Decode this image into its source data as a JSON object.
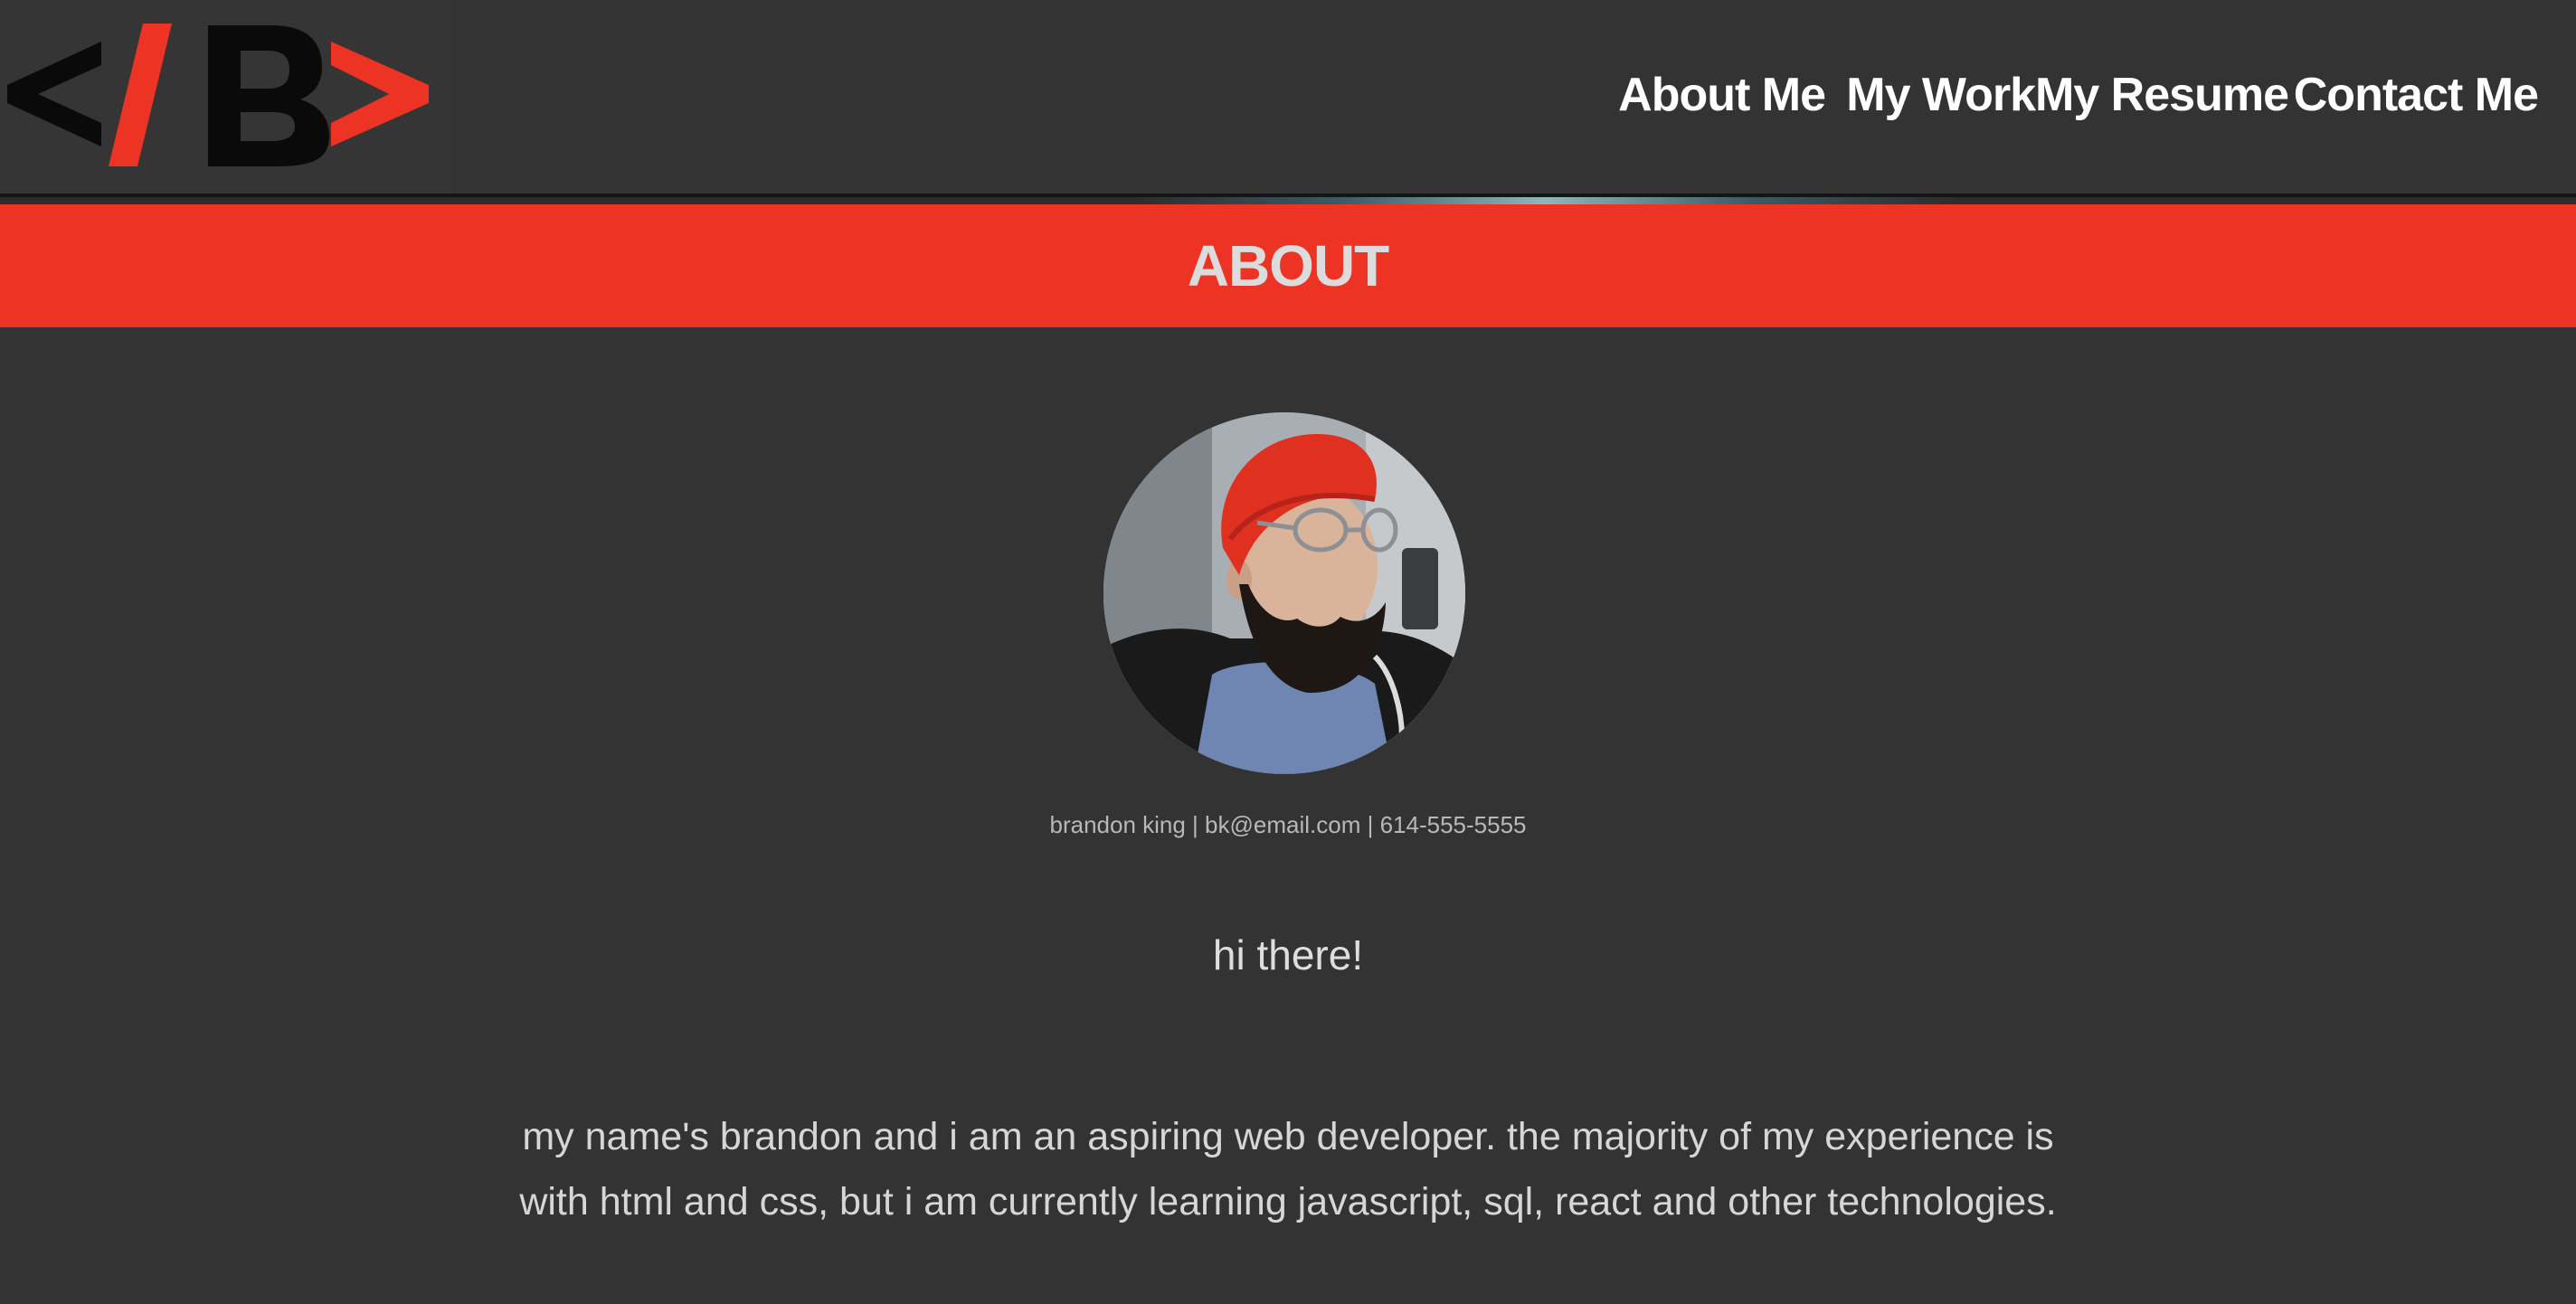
{
  "logo": {
    "glyphs": [
      "<",
      "/",
      "B",
      ">"
    ],
    "colors": {
      "dark": "#0a0a0a",
      "accent": "#ec3324"
    }
  },
  "nav": {
    "items": [
      {
        "label": "About Me"
      },
      {
        "label": "My Work"
      },
      {
        "label": "My Resume"
      },
      {
        "label": "Contact Me"
      }
    ]
  },
  "banner": {
    "title": "ABOUT",
    "color": "#ec3324"
  },
  "profile": {
    "avatar_icon": "profile-photo",
    "contact": "brandon king | bk@email.com | 614-555-5555"
  },
  "content": {
    "greeting": "hi there!",
    "bio": "my name's brandon and i am an aspiring web developer. the majority of my experience is with html and css, but i am currently learning javascript, sql, react and other technologies."
  },
  "colors": {
    "background": "#333333",
    "accent": "#ec3324",
    "text": "#d6d6d6"
  }
}
